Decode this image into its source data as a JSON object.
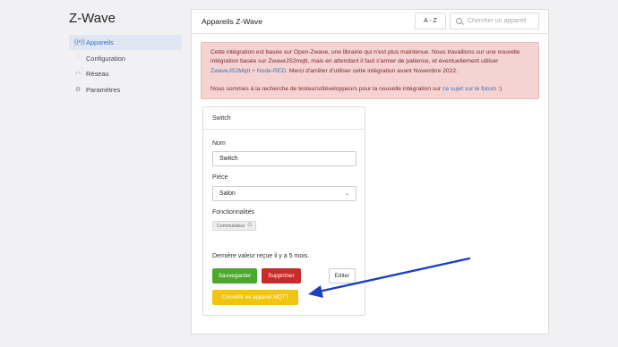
{
  "app_title": "Z-Wave",
  "sidebar": {
    "items": [
      {
        "icon": "zwave-icon",
        "label": "Appareils",
        "active": true
      },
      {
        "icon": "settings-sliders-icon",
        "label": "Configuration",
        "active": false
      },
      {
        "icon": "wifi-icon",
        "label": "Réseau",
        "active": false
      },
      {
        "icon": "gear-icon",
        "label": "Paramètres",
        "active": false
      }
    ]
  },
  "panel": {
    "title": "Appareils Z-Wave",
    "sort_label": "A - Z",
    "search_placeholder": "Chercher un appareil"
  },
  "alert": {
    "p1_a": "Cette intégration est basée sur Open-Zwave, une librairie qui n'est plus maintenue. Nous travaillons sur une nouvelle intégration basée sur ZwaveJS2mqtt, mais en attendant il faut s'armer de patience, et éventuellement utiliser ",
    "p1_link": "ZwaveJS2Mqtt + Node-RED",
    "p1_b": ". Merci d'arrêter d'utiliser cette intégration avant Novembre 2022.",
    "p2_a": "Nous sommes à la recherche de testeurs/développeurs pour la nouvelle intégration sur ",
    "p2_link": "ce sujet sur le forum",
    "p2_b": " :)"
  },
  "device": {
    "header": "Switch",
    "name_label": "Nom",
    "name_value": "Switch",
    "room_label": "Pièce",
    "room_value": "Salon",
    "features_label": "Fonctionnalités",
    "feature_chip": "Commutateur",
    "last_value": "Dernière valeur reçue il y a 5 mois.",
    "save_label": "Sauvegarder",
    "delete_label": "Supprimer",
    "edit_label": "Editer",
    "convert_label": "Convertir en appareil MQTT"
  },
  "colors": {
    "accent": "#3d6fb6",
    "save": "#4ca82d",
    "delete": "#c92b2b",
    "convert": "#f1c40f",
    "alert_bg": "#f5d3d3",
    "annotation_arrow": "#1d3fc6"
  }
}
